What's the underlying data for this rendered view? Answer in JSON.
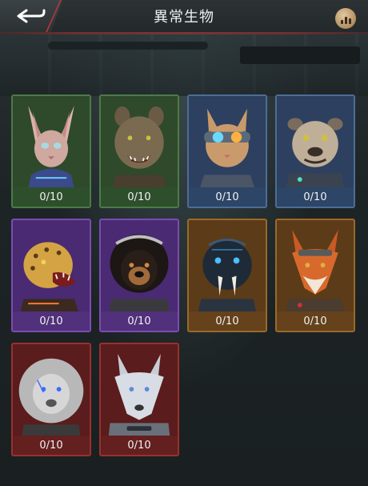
{
  "header": {
    "title": "異常生物",
    "back_icon": "back-arrow-icon",
    "ranking_icon": "bar-chart-icon"
  },
  "creatures": [
    {
      "name": "sphynx-cat",
      "rarity": "green",
      "progress": "0/10"
    },
    {
      "name": "hyena",
      "rarity": "green",
      "progress": "0/10"
    },
    {
      "name": "goggle-cat",
      "rarity": "blue",
      "progress": "0/10"
    },
    {
      "name": "bulldog",
      "rarity": "blue",
      "progress": "0/10"
    },
    {
      "name": "leopard",
      "rarity": "purple",
      "progress": "0/10"
    },
    {
      "name": "mastiff",
      "rarity": "purple",
      "progress": "0/10"
    },
    {
      "name": "sabertooth",
      "rarity": "orange",
      "progress": "0/10"
    },
    {
      "name": "fox",
      "rarity": "orange",
      "progress": "0/10"
    },
    {
      "name": "lion",
      "rarity": "red",
      "progress": "0/10"
    },
    {
      "name": "wolf",
      "rarity": "red",
      "progress": "0/10"
    }
  ],
  "colors": {
    "green": "#2e4f2c",
    "blue": "#2d4566",
    "purple": "#51307c",
    "orange": "#65421c",
    "red": "#641f1f"
  }
}
